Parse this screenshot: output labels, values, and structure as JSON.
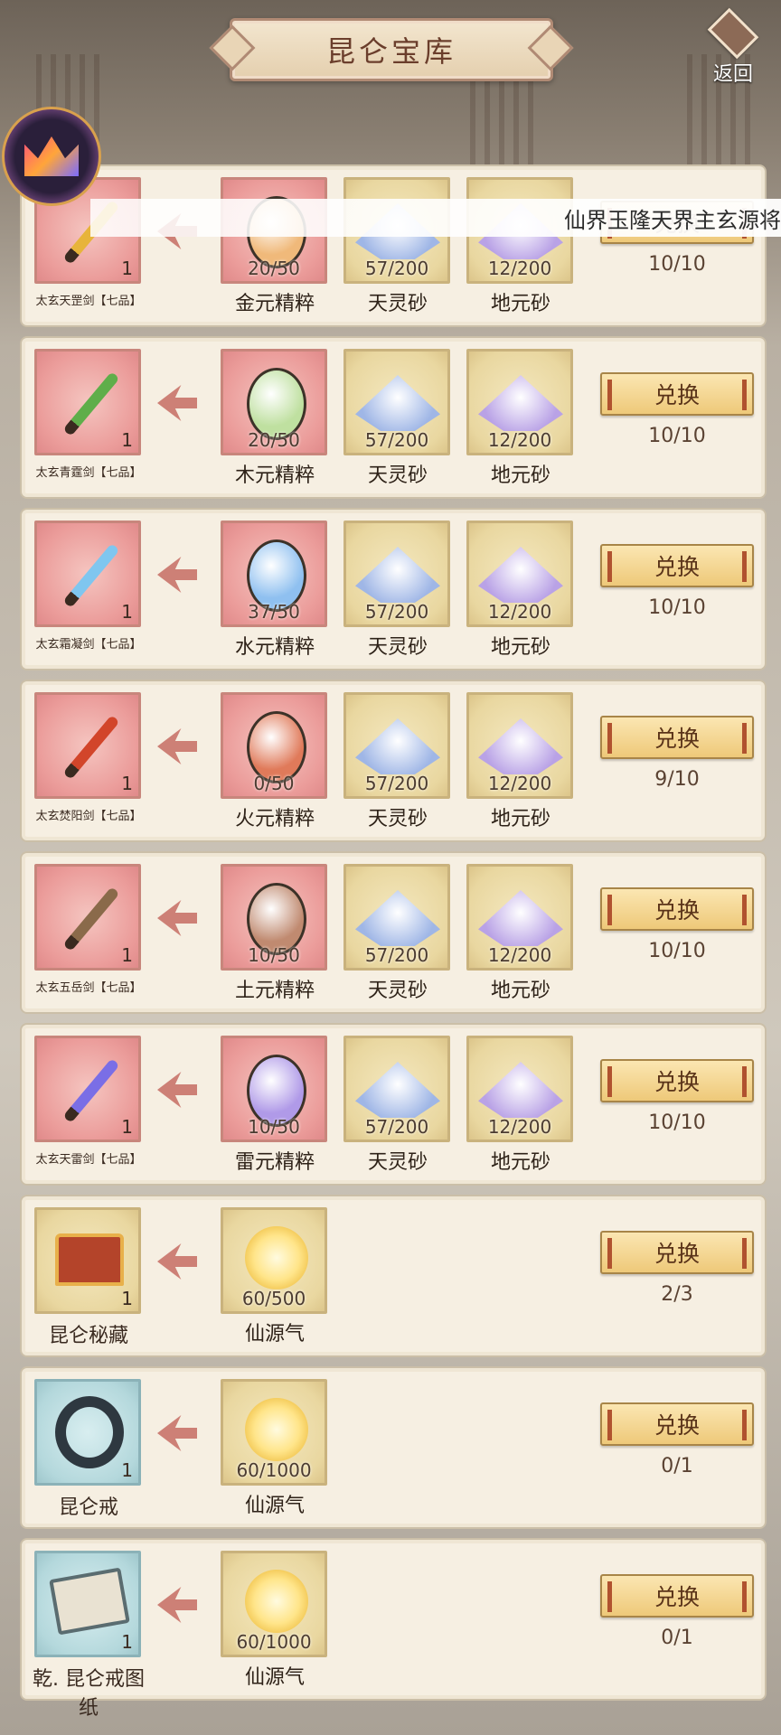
{
  "header": {
    "title": "昆仑宝库",
    "back_label": "返回"
  },
  "ticker": "仙界玉隆天界主玄源将",
  "exchange_label": "兑换",
  "rows": [
    {
      "reward_name": "太玄天罡剑【七品】",
      "reward_qty": "1",
      "limit": "10/10",
      "costs": [
        {
          "name": "金元精粹",
          "count": "20/50"
        },
        {
          "name": "天灵砂",
          "count": "57/200"
        },
        {
          "name": "地元砂",
          "count": "12/200"
        }
      ]
    },
    {
      "reward_name": "太玄青霆剑【七品】",
      "reward_qty": "1",
      "limit": "10/10",
      "costs": [
        {
          "name": "木元精粹",
          "count": "20/50"
        },
        {
          "name": "天灵砂",
          "count": "57/200"
        },
        {
          "name": "地元砂",
          "count": "12/200"
        }
      ]
    },
    {
      "reward_name": "太玄霜凝剑【七品】",
      "reward_qty": "1",
      "limit": "10/10",
      "costs": [
        {
          "name": "水元精粹",
          "count": "37/50"
        },
        {
          "name": "天灵砂",
          "count": "57/200"
        },
        {
          "name": "地元砂",
          "count": "12/200"
        }
      ]
    },
    {
      "reward_name": "太玄焚阳剑【七品】",
      "reward_qty": "1",
      "limit": "9/10",
      "costs": [
        {
          "name": "火元精粹",
          "count": "0/50"
        },
        {
          "name": "天灵砂",
          "count": "57/200"
        },
        {
          "name": "地元砂",
          "count": "12/200"
        }
      ]
    },
    {
      "reward_name": "太玄五岳剑【七品】",
      "reward_qty": "1",
      "limit": "10/10",
      "costs": [
        {
          "name": "土元精粹",
          "count": "10/50"
        },
        {
          "name": "天灵砂",
          "count": "57/200"
        },
        {
          "name": "地元砂",
          "count": "12/200"
        }
      ]
    },
    {
      "reward_name": "太玄天雷剑【七品】",
      "reward_qty": "1",
      "limit": "10/10",
      "costs": [
        {
          "name": "雷元精粹",
          "count": "10/50"
        },
        {
          "name": "天灵砂",
          "count": "57/200"
        },
        {
          "name": "地元砂",
          "count": "12/200"
        }
      ]
    },
    {
      "reward_name": "昆仑秘藏",
      "reward_qty": "1",
      "limit": "2/3",
      "costs": [
        {
          "name": "仙源气",
          "count": "60/500"
        }
      ]
    },
    {
      "reward_name": "昆仑戒",
      "reward_qty": "1",
      "limit": "0/1",
      "costs": [
        {
          "name": "仙源气",
          "count": "60/1000"
        }
      ]
    },
    {
      "reward_name": "乾. 昆仑戒图纸",
      "reward_qty": "1",
      "limit": "0/1",
      "costs": [
        {
          "name": "仙源气",
          "count": "60/1000"
        }
      ]
    }
  ],
  "colors": {
    "sword": [
      "#e7b43a",
      "#5fae4a",
      "#7fc6ef",
      "#d2452a",
      "#8a6a4a",
      "#7a6ee6"
    ],
    "gem": [
      "#f0b97a",
      "#bfe0a0",
      "#8fc0f0",
      "#e07a5a",
      "#c08a70",
      "#b09ae8"
    ],
    "sand_sky": "#9fb6e6",
    "sand_earth": "#b9a2e6"
  }
}
